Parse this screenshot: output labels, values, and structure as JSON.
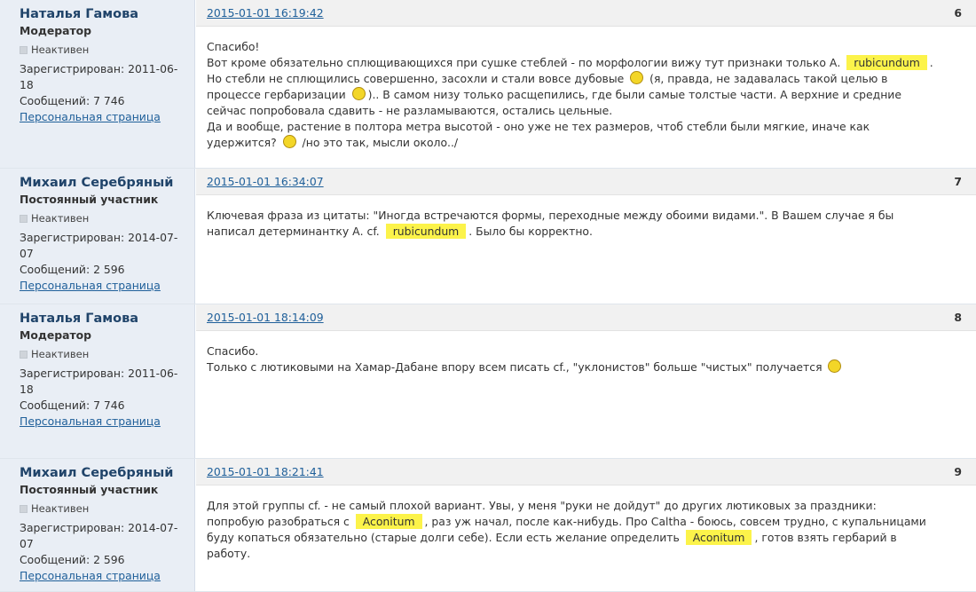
{
  "posts": [
    {
      "author": "Наталья Гамова",
      "role": "Модератор",
      "status": "Неактивен",
      "registered": "Зарегистрирован: 2011-06-18",
      "messages": "Сообщений: 7 746",
      "profile_link": "Персональная страница",
      "date": "2015-01-01 16:19:42",
      "number": "6",
      "body_lines": [
        [
          "Спасибо!"
        ],
        [
          "Вот кроме обязательно сплющивающихся при сушке стеблей - по морфологии вижу тут признаки только А. ",
          {
            "hl": "rubicundum"
          },
          "."
        ],
        [
          "Но стебли не сплющились совершенно, засохли и стали вовсе дубовые ",
          {
            "smile": "confused-smiley-icon"
          },
          " (я, правда, не задавалась такой целью в"
        ],
        [
          "процессе гербаризации ",
          {
            "smile": "smile-smiley-icon"
          },
          ").. В самом низу только расщепились, где были самые толстые части. А верхние и средние"
        ],
        [
          "сейчас попробовала сдавить - не разламываются, остались цельные."
        ],
        [
          "Да и вообще, растение в полтора метра высотой - оно уже не тех размеров, чтоб стебли были мягкие, иначе как"
        ],
        [
          "удержится? ",
          {
            "smile": "roll-eyes-smiley-icon"
          },
          " /но это так, мысли около../"
        ]
      ]
    },
    {
      "author": "Михаил Серебряный",
      "role": "Постоянный участник",
      "status": "Неактивен",
      "registered": "Зарегистрирован: 2014-07-07",
      "messages": "Сообщений: 2 596",
      "profile_link": "Персональная страница",
      "date": "2015-01-01 16:34:07",
      "number": "7",
      "body_lines": [
        [
          "Ключевая фраза из цитаты: \"Иногда встречаются формы, переходные между обоими видами.\". В Вашем случае я бы"
        ],
        [
          "написал детерминантку А. cf. ",
          {
            "hl": "rubicundum"
          },
          ". Было бы корректно."
        ]
      ]
    },
    {
      "author": "Наталья Гамова",
      "role": "Модератор",
      "status": "Неактивен",
      "registered": "Зарегистрирован: 2011-06-18",
      "messages": "Сообщений: 7 746",
      "profile_link": "Персональная страница",
      "date": "2015-01-01 18:14:09",
      "number": "8",
      "body_lines": [
        [
          "Спасибо."
        ],
        [
          "Только с лютиковыми на Хамар-Дабане впору всем писать cf., \"уклонистов\" больше \"чистых\" получается ",
          {
            "smile": "big-grin-smiley-icon"
          }
        ]
      ]
    },
    {
      "author": "Михаил Серебряный",
      "role": "Постоянный участник",
      "status": "Неактивен",
      "registered": "Зарегистрирован: 2014-07-07",
      "messages": "Сообщений: 2 596",
      "profile_link": "Персональная страница",
      "date": "2015-01-01 18:21:41",
      "number": "9",
      "body_lines": [
        [
          "Для этой группы cf. - не самый плохой вариант. Увы, у меня \"руки не дойдут\" до других лютиковых за праздники:"
        ],
        [
          "попробую разобраться с ",
          {
            "hl": "Aconitum"
          },
          ", раз уж начал, после как-нибудь. Про Caltha - боюсь, совсем трудно, с купальницами"
        ],
        [
          "буду копаться обязательно (старые долги себе). Если есть желание определить ",
          {
            "hl": "Aconitum"
          },
          ", готов взять гербарий в"
        ],
        [
          "работу."
        ]
      ]
    }
  ]
}
